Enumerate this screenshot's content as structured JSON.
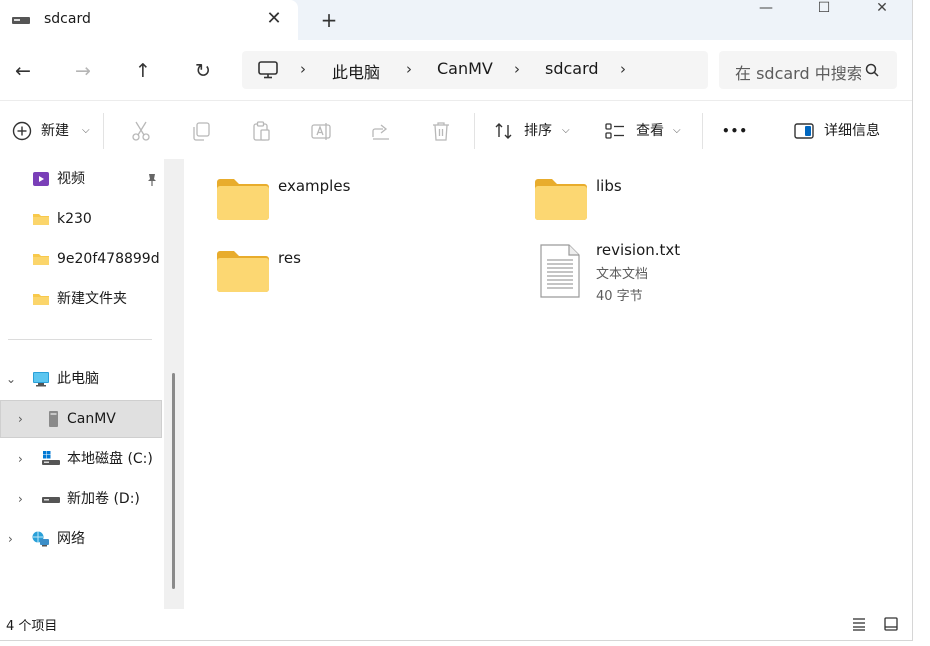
{
  "tab": {
    "title": "sdcard",
    "close_glyph": "✕",
    "new_tab_glyph": "+"
  },
  "window_controls": {
    "minimize": "—",
    "maximize": "☐",
    "close": "✕"
  },
  "nav": {
    "back": "←",
    "forward": "→",
    "up": "↑",
    "refresh": "↻"
  },
  "breadcrumb": {
    "items": [
      "此电脑",
      "CanMV",
      "sdcard"
    ],
    "separator": "›"
  },
  "search": {
    "placeholder": "在 sdcard 中搜索"
  },
  "toolbar": {
    "new_label": "新建",
    "sort_label": "排序",
    "view_label": "查看",
    "more_label": "•••",
    "details_label": "详细信息"
  },
  "sidebar": {
    "quick": [
      {
        "label": "视频",
        "icon": "video-folder-icon",
        "pinned": true
      },
      {
        "label": "k230",
        "icon": "folder-icon"
      },
      {
        "label": "9e20f478899d",
        "icon": "folder-icon"
      },
      {
        "label": "新建文件夹",
        "icon": "folder-icon"
      }
    ],
    "tree": [
      {
        "label": "此电脑",
        "icon": "this-pc-icon",
        "expanded": true
      },
      {
        "label": "CanMV",
        "icon": "drive-icon",
        "selected": true
      },
      {
        "label": "本地磁盘 (C:)",
        "icon": "windows-drive-icon"
      },
      {
        "label": "新加卷 (D:)",
        "icon": "drive-icon"
      },
      {
        "label": "网络",
        "icon": "network-icon"
      }
    ]
  },
  "items": [
    {
      "name": "examples",
      "type": "folder"
    },
    {
      "name": "libs",
      "type": "folder"
    },
    {
      "name": "res",
      "type": "folder"
    },
    {
      "name": "revision.txt",
      "type": "file",
      "kind": "文本文档",
      "size": "40 字节"
    }
  ],
  "status": {
    "count": "4 个项目"
  },
  "colors": {
    "folder": "#f8c94c",
    "folder_dark": "#e8ac2c",
    "accent": "#0067c0",
    "selected_bg": "#e0e0e0"
  }
}
